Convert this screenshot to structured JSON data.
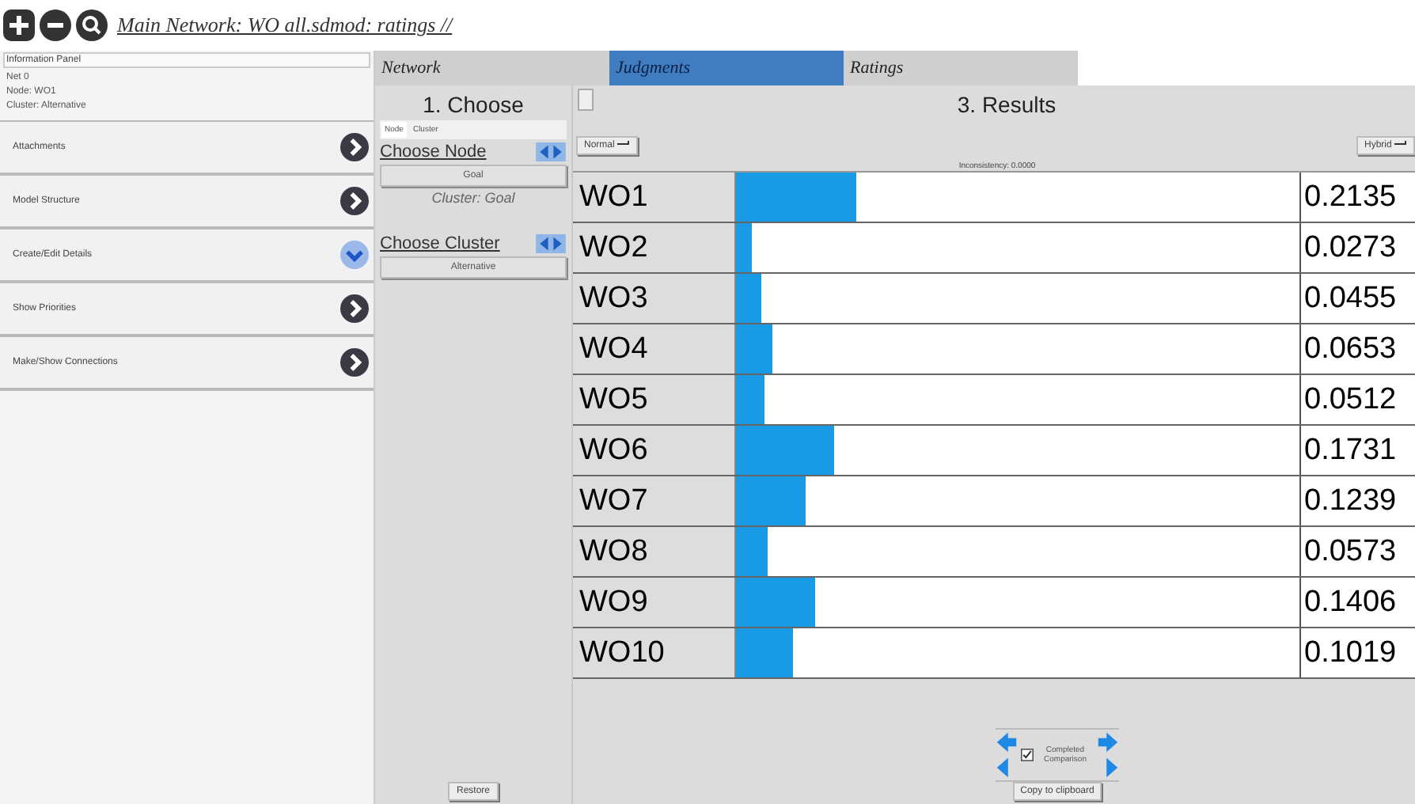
{
  "toolbar": {
    "path": "Main Network: WO all.sdmod: ratings //"
  },
  "info_panel": {
    "title": "Information Panel",
    "lines": [
      "Net 0",
      "Node: WO1",
      "Cluster: Alternative"
    ]
  },
  "sections": [
    {
      "label": "Attachments",
      "expanded": false
    },
    {
      "label": "Model Structure",
      "expanded": false
    },
    {
      "label": "Create/Edit Details",
      "expanded": true
    },
    {
      "label": "Show Priorities",
      "expanded": false
    },
    {
      "label": "Make/Show Connections",
      "expanded": false
    }
  ],
  "tabs": [
    {
      "label": "Network",
      "selected": false
    },
    {
      "label": "Judgments",
      "selected": true
    },
    {
      "label": "Ratings",
      "selected": false
    }
  ],
  "choose": {
    "title": "1. Choose",
    "subtabs": [
      {
        "label": "Node",
        "selected": true
      },
      {
        "label": "Cluster",
        "selected": false
      }
    ],
    "node_label": "Choose Node",
    "node_value": "Goal",
    "cluster_note": "Cluster: Goal",
    "cluster_label": "Choose Cluster",
    "cluster_value": "Alternative",
    "restore": "Restore"
  },
  "results": {
    "title": "3. Results",
    "mode": "Normal",
    "inconsistency": "Inconsistency: 0.0000",
    "hybrid": "Hybrid",
    "rows": [
      {
        "name": "WO1",
        "value": "0.2135",
        "level": 0.2135
      },
      {
        "name": "WO2",
        "value": "0.0273",
        "level": 0.0273
      },
      {
        "name": "WO3",
        "value": "0.0455",
        "level": 0.0455
      },
      {
        "name": "WO4",
        "value": "0.0653",
        "level": 0.0653
      },
      {
        "name": "WO5",
        "value": "0.0512",
        "level": 0.0512
      },
      {
        "name": "WO6",
        "value": "0.1731",
        "level": 0.1731
      },
      {
        "name": "WO7",
        "value": "0.1239",
        "level": 0.1239
      },
      {
        "name": "WO8",
        "value": "0.0573",
        "level": 0.0573
      },
      {
        "name": "WO9",
        "value": "0.1406",
        "level": 0.1406
      },
      {
        "name": "WO10",
        "value": "0.1019",
        "level": 0.1019
      }
    ],
    "completed": {
      "label": "Completed Comparison",
      "checked": true
    },
    "copy": "Copy to clipboard"
  }
}
